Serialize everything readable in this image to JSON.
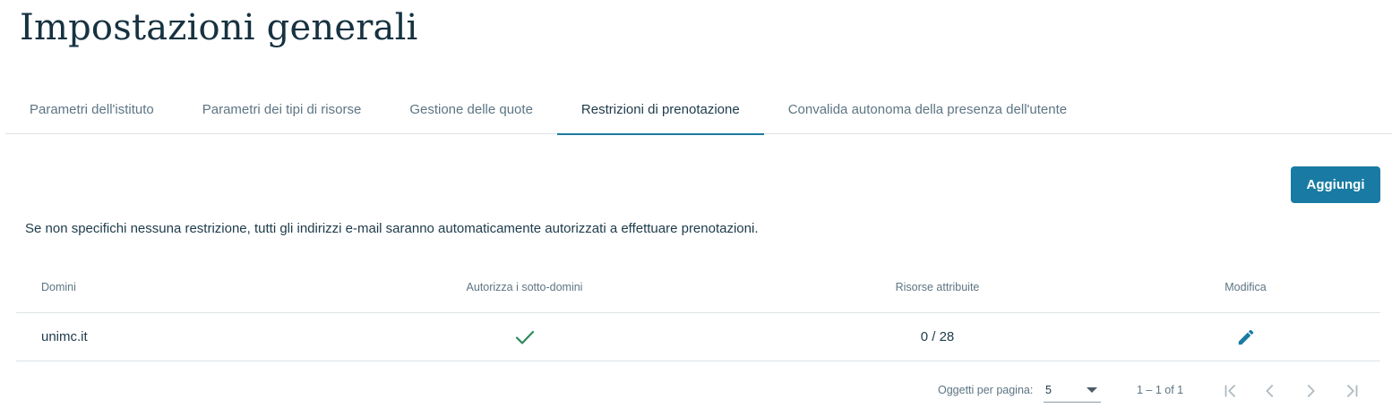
{
  "page": {
    "title": "Impostazioni generali"
  },
  "tabs": [
    {
      "label": "Parametri dell'istituto"
    },
    {
      "label": "Parametri dei tipi di risorse"
    },
    {
      "label": "Gestione delle quote"
    },
    {
      "label": "Restrizioni di prenotazione",
      "active": true
    },
    {
      "label": "Convalida autonoma della presenza dell'utente"
    }
  ],
  "toolbar": {
    "add_label": "Aggiungi"
  },
  "info": {
    "text": "Se non specifichi nessuna restrizione, tutti gli indirizzi e-mail saranno automaticamente autorizzati a effettuare prenotazioni."
  },
  "table": {
    "headers": [
      "Domini",
      "Autorizza i sotto-domini",
      "Risorse attribuite",
      "Modifica"
    ],
    "rows": [
      {
        "domain": "unimc.it",
        "allow_subdomains_icon": "check-icon",
        "resources": "0 / 28",
        "edit_icon": "pencil-icon"
      }
    ]
  },
  "paginator": {
    "items_per_page_label": "Oggetti per pagina:",
    "page_size": "5",
    "range_label": "1 – 1 of 1",
    "buttons": [
      "first-page-icon",
      "previous-page-icon",
      "next-page-icon",
      "last-page-icon"
    ]
  },
  "colors": {
    "accent": "#197ba3",
    "check": "#2e8a5c",
    "text": "#1d3a4a",
    "muted": "#5d7583"
  }
}
